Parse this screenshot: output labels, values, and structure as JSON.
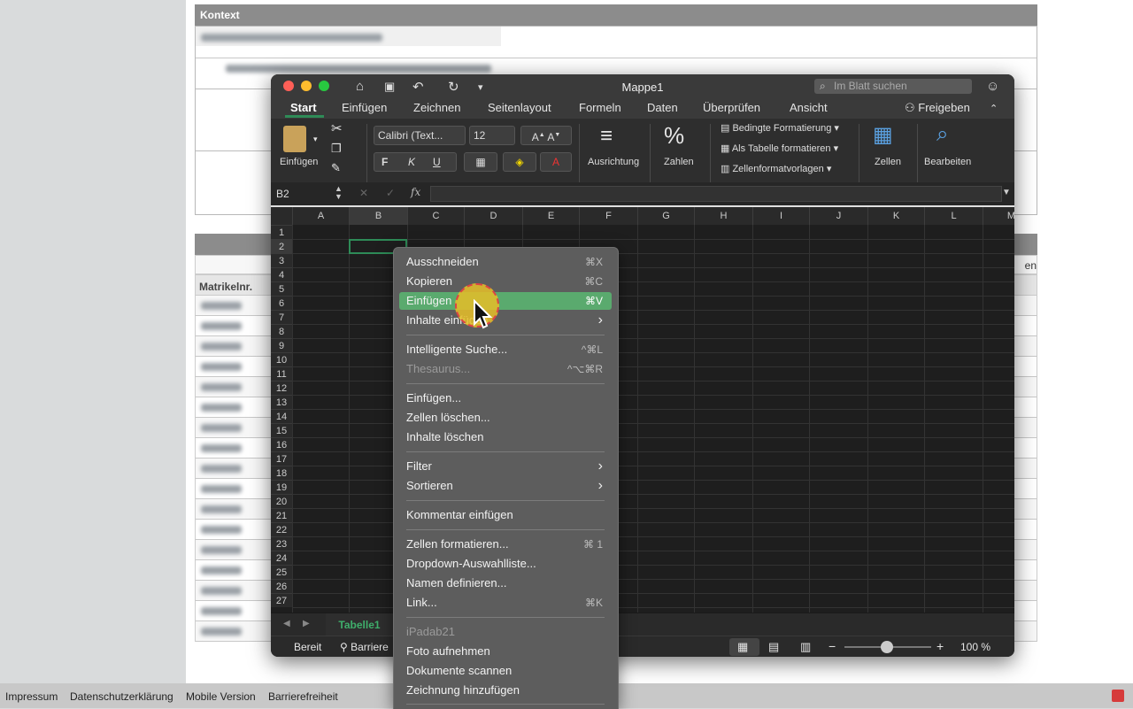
{
  "background": {
    "kontext_title": "Kontext",
    "table_header": "Matrikelnr.",
    "table_header_right": "en"
  },
  "footer": {
    "links": [
      "Impressum",
      "Datenschutzerklärung",
      "Mobile Version",
      "Barrierefreiheit"
    ]
  },
  "excel": {
    "title": "Mappe1",
    "search_placeholder": "Im Blatt suchen",
    "tabs": [
      "Start",
      "Einfügen",
      "Zeichnen",
      "Seitenlayout",
      "Formeln",
      "Daten",
      "Überprüfen",
      "Ansicht"
    ],
    "share_label": "Freigeben",
    "ribbon": {
      "paste_label": "Einfügen",
      "font_name": "Calibri (Text...",
      "font_size": "12",
      "bold": "F",
      "italic": "K",
      "underline": "U",
      "align_label": "Ausrichtung",
      "number_label": "Zahlen",
      "cond_format": "Bedingte Formatierung",
      "as_table": "Als Tabelle formatieren",
      "cell_styles": "Zellenformatvorlagen",
      "cells_label": "Zellen",
      "edit_label": "Bearbeiten"
    },
    "name_box": "B2",
    "fx": "fx",
    "columns": [
      "A",
      "B",
      "C",
      "D",
      "E",
      "F",
      "G",
      "H",
      "I",
      "J",
      "K",
      "L",
      "M"
    ],
    "rows": [
      "1",
      "2",
      "3",
      "4",
      "5",
      "6",
      "7",
      "8",
      "9",
      "10",
      "11",
      "12",
      "13",
      "14",
      "15",
      "16",
      "17",
      "18",
      "19",
      "20",
      "21",
      "22",
      "23",
      "24",
      "25",
      "26",
      "27"
    ],
    "sheet_tab": "Tabelle1",
    "status_ready": "Bereit",
    "status_accessibility": "Barriere",
    "zoom": "100 %"
  },
  "context_menu": {
    "items": [
      {
        "label": "Ausschneiden",
        "shortcut": "⌘X"
      },
      {
        "label": "Kopieren",
        "shortcut": "⌘C"
      },
      {
        "label": "Einfügen",
        "shortcut": "⌘V"
      },
      {
        "label": "Inhalte einfügen",
        "shortcut": ""
      },
      {
        "label": "Intelligente Suche...",
        "shortcut": "^⌘L"
      },
      {
        "label": "Thesaurus...",
        "shortcut": "^⌥⌘R"
      },
      {
        "label": "Einfügen...",
        "shortcut": ""
      },
      {
        "label": "Zellen löschen...",
        "shortcut": ""
      },
      {
        "label": "Inhalte löschen",
        "shortcut": ""
      },
      {
        "label": "Filter",
        "shortcut": ""
      },
      {
        "label": "Sortieren",
        "shortcut": ""
      },
      {
        "label": "Kommentar einfügen",
        "shortcut": ""
      },
      {
        "label": "Zellen formatieren...",
        "shortcut": "⌘ 1"
      },
      {
        "label": "Dropdown-Auswahlliste...",
        "shortcut": ""
      },
      {
        "label": "Namen definieren...",
        "shortcut": ""
      },
      {
        "label": "Link...",
        "shortcut": "⌘K"
      },
      {
        "label": "iPadab21",
        "shortcut": ""
      },
      {
        "label": "Foto aufnehmen",
        "shortcut": ""
      },
      {
        "label": "Dokumente scannen",
        "shortcut": ""
      },
      {
        "label": "Zeichnung hinzufügen",
        "shortcut": ""
      }
    ]
  }
}
